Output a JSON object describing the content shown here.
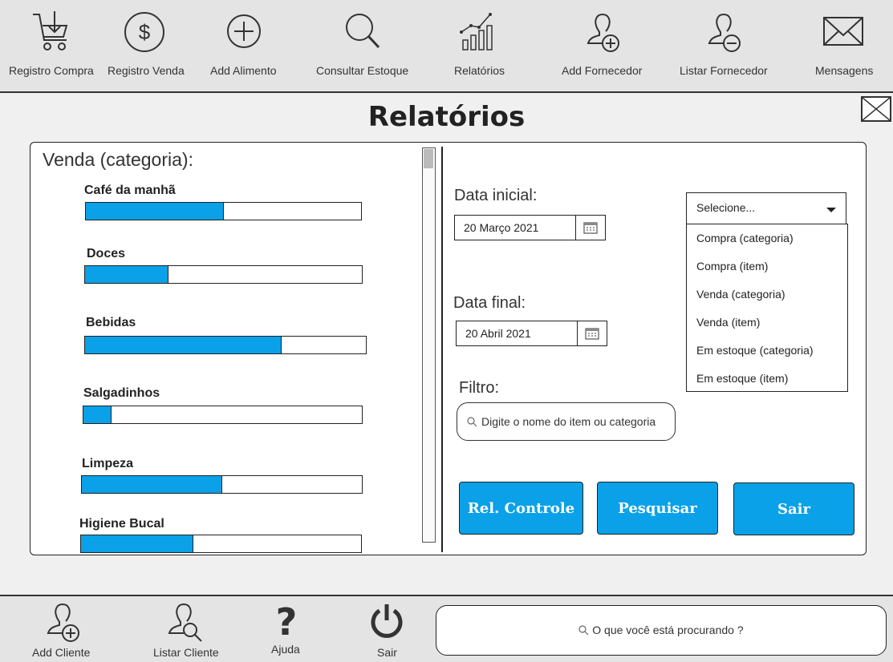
{
  "toolbar": {
    "items": [
      {
        "label": "Registro Compra",
        "icon": "cart-download-icon"
      },
      {
        "label": "Registro Venda",
        "icon": "dollar-circle-icon"
      },
      {
        "label": "Add Alimento",
        "icon": "plus-circle-icon"
      },
      {
        "label": "Consultar Estoque",
        "icon": "search-icon"
      },
      {
        "label": "Relatórios",
        "icon": "chart-icon"
      },
      {
        "label": "Add Fornecedor",
        "icon": "user-add-icon"
      },
      {
        "label": "Listar Fornecedor",
        "icon": "user-remove-icon"
      },
      {
        "label": "Mensagens",
        "icon": "envelope-icon"
      }
    ]
  },
  "page": {
    "title": "Relatórios"
  },
  "sales_panel": {
    "title": "Venda (categoria):",
    "categories": [
      {
        "label": "Café da manhã",
        "fraction": 0.5
      },
      {
        "label": "Doces",
        "fraction": 0.3
      },
      {
        "label": "Bebidas",
        "fraction": 0.7
      },
      {
        "label": "Salgadinhos",
        "fraction": 0.1
      },
      {
        "label": "Limpeza",
        "fraction": 0.5
      },
      {
        "label": "Higiene Bucal",
        "fraction": 0.4
      }
    ]
  },
  "form": {
    "start_label": "Data inicial:",
    "start_value": "20 Março 2021",
    "end_label": "Data final:",
    "end_value": "20 Abril 2021",
    "filter_label": "Filtro:",
    "filter_placeholder": "Digite o nome do item ou categoria",
    "select_value": "Selecione...",
    "select_options": [
      "Compra (categoria)",
      "Compra (item)",
      "Venda (categoria)",
      "Venda (item)",
      "Em estoque (categoria)",
      "Em estoque (item)"
    ]
  },
  "buttons": {
    "rel_controle": "Rel. Controle",
    "pesquisar": "Pesquisar",
    "sair": "Sair"
  },
  "bottombar": {
    "items": [
      {
        "label": "Add Cliente",
        "icon": "user-add-icon"
      },
      {
        "label": "Listar Cliente",
        "icon": "user-search-icon"
      },
      {
        "label": "Ajuda",
        "icon": "question-icon"
      },
      {
        "label": "Sair",
        "icon": "power-icon"
      }
    ],
    "search_placeholder": "O que você está procurando ?"
  },
  "colors": {
    "accent": "#0aa1e8",
    "toolbar_bg": "#e4e4e4",
    "page_bg": "#f0f0f0"
  }
}
